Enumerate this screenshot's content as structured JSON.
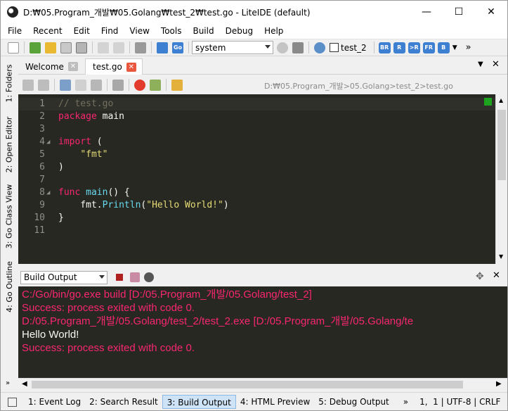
{
  "window": {
    "title": "D:₩05.Program_개발₩05.Golang₩test_2₩test.go - LiteIDE (default)",
    "minimize_glyph": "—",
    "maximize_glyph": "☐",
    "close_glyph": "✕"
  },
  "menu": [
    "File",
    "Recent",
    "Edit",
    "Find",
    "View",
    "Tools",
    "Build",
    "Debug",
    "Help"
  ],
  "toolbar": {
    "env_select": "system",
    "build_target": "test_2",
    "badges": [
      "BR",
      "R",
      ">R",
      "FR",
      "B"
    ],
    "overflow": "»"
  },
  "side_tabs": [
    "1: Folders",
    "2: Open Editor",
    "3: Go Class View",
    "4: Go Outline"
  ],
  "editor_tabs": [
    {
      "label": "Welcome",
      "active": false
    },
    {
      "label": "test.go",
      "active": true
    }
  ],
  "breadcrumb": "D:₩05.Program_개발>05.Golang>test_2>test.go",
  "code_lines": [
    {
      "n": "1",
      "fold": "",
      "tokens": [
        {
          "t": "// test.go",
          "c": "c"
        }
      ]
    },
    {
      "n": "2",
      "fold": "",
      "tokens": [
        {
          "t": "package",
          "c": "k"
        },
        {
          "t": " main",
          "c": "t"
        }
      ]
    },
    {
      "n": "3",
      "fold": "",
      "tokens": []
    },
    {
      "n": "4",
      "fold": "◢",
      "tokens": [
        {
          "t": "import",
          "c": "k"
        },
        {
          "t": " (",
          "c": "t"
        }
      ]
    },
    {
      "n": "5",
      "fold": "",
      "tokens": [
        {
          "t": "    ",
          "c": "t"
        },
        {
          "t": "\"fmt\"",
          "c": "s"
        }
      ]
    },
    {
      "n": "6",
      "fold": "",
      "tokens": [
        {
          "t": ")",
          "c": "t"
        }
      ]
    },
    {
      "n": "7",
      "fold": "",
      "tokens": []
    },
    {
      "n": "8",
      "fold": "◢",
      "tokens": [
        {
          "t": "func",
          "c": "k"
        },
        {
          "t": " ",
          "c": "t"
        },
        {
          "t": "main",
          "c": "f"
        },
        {
          "t": "() {",
          "c": "t"
        }
      ]
    },
    {
      "n": "9",
      "fold": "",
      "tokens": [
        {
          "t": "    fmt.",
          "c": "t"
        },
        {
          "t": "Println",
          "c": "f"
        },
        {
          "t": "(",
          "c": "t"
        },
        {
          "t": "\"Hello World!\"",
          "c": "s"
        },
        {
          "t": ")",
          "c": "t"
        }
      ]
    },
    {
      "n": "10",
      "fold": "",
      "tokens": [
        {
          "t": "}",
          "c": "t"
        }
      ]
    },
    {
      "n": "11",
      "fold": "",
      "tokens": []
    }
  ],
  "output_panel": {
    "select": "Build Output",
    "lines": [
      {
        "text": "C:/Go/bin/go.exe build [D:/05.Program_개발/05.Golang/test_2]",
        "color": "#f92672"
      },
      {
        "text": "Success: process exited with code 0.",
        "color": "#f92672"
      },
      {
        "text": "D:/05.Program_개발/05.Golang/test_2/test_2.exe  [D:/05.Program_개발/05.Golang/te",
        "color": "#f92672"
      },
      {
        "text": "Hello World!",
        "color": "#f8f8f2"
      },
      {
        "text": "Success: process exited with code 0.",
        "color": "#f92672"
      }
    ]
  },
  "bottom_tabs": [
    {
      "label": "1: Event Log",
      "active": false
    },
    {
      "label": "2: Search Result",
      "active": false
    },
    {
      "label": "3: Build Output",
      "active": true
    },
    {
      "label": "4: HTML Preview",
      "active": false
    },
    {
      "label": "5: Debug Output",
      "active": false
    }
  ],
  "status": {
    "overflow": "»",
    "position": "1,  1 | UTF-8 | CRLF"
  },
  "colors": {
    "editor_bg": "#272822",
    "keyword": "#f92672",
    "string": "#e6db74",
    "comment": "#75715e",
    "function": "#66d9ef",
    "accent": "#3d7fd0"
  }
}
